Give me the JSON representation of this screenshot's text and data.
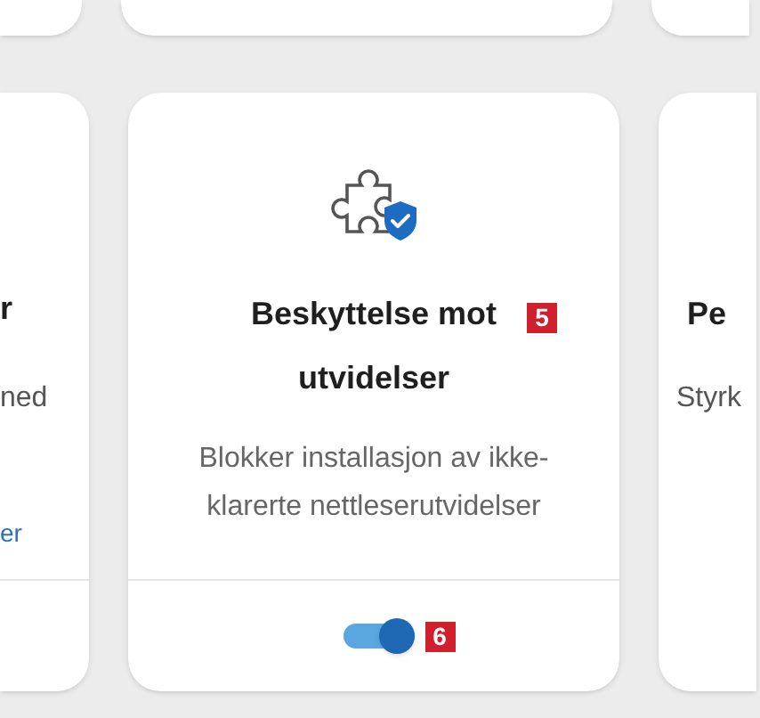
{
  "left_card": {
    "title": "r",
    "description": "ned",
    "link": "er"
  },
  "feature_card": {
    "title": "Beskyttelse mot utvidelser",
    "title_badge": "5",
    "description": "Blokker installasjon av ikke-klarerte nettleserutvidelser",
    "toggle": {
      "on": true,
      "badge": "6"
    }
  },
  "right_card": {
    "title": "Pe",
    "description": "Styrk"
  }
}
